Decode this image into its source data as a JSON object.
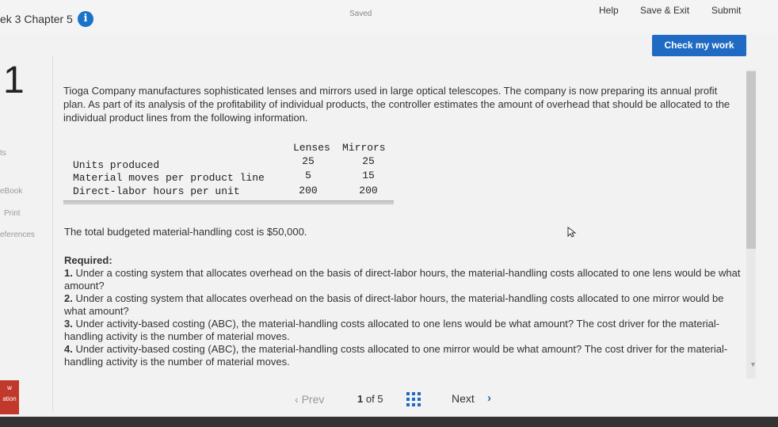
{
  "header": {
    "chapter": "ek 3 Chapter 5",
    "info_icon_glyph": "i",
    "status": "Saved",
    "help": "Help",
    "save_exit": "Save & Exit",
    "submit": "Submit",
    "check_my_work": "Check my work"
  },
  "question_number": "1",
  "sidebar": {
    "items": [
      "ts",
      "eBook",
      "Print",
      "eferences"
    ]
  },
  "problem": {
    "text": "Tioga Company manufactures sophisticated lenses and mirrors used in large optical telescopes. The company is now preparing its annual profit plan. As part of its analysis of the profitability of individual products, the controller estimates the amount of overhead that should be allocated to the individual product lines from the following information.",
    "table": {
      "columns": [
        "Lenses",
        "Mirrors"
      ],
      "rows": [
        {
          "label": "Units produced",
          "values": [
            "25",
            "25"
          ]
        },
        {
          "label": "Material moves per product line",
          "values": [
            "5",
            "15"
          ]
        },
        {
          "label": "Direct-labor hours per unit",
          "values": [
            "200",
            "200"
          ]
        }
      ]
    },
    "budget": "The total budgeted material-handling cost is $50,000."
  },
  "required": {
    "title": "Required:",
    "items": [
      {
        "num": "1.",
        "text": "Under a costing system that allocates overhead on the basis of direct-labor hours, the material-handling costs allocated to one lens would be what amount?"
      },
      {
        "num": "2.",
        "text": "Under a costing system that allocates overhead on the basis of direct-labor hours, the material-handling costs allocated to one mirror would be what amount?"
      },
      {
        "num": "3.",
        "text": "Under activity-based costing (ABC), the material-handling costs allocated to one lens would be what amount? The cost driver for the material-handling activity is the number of material moves."
      },
      {
        "num": "4.",
        "text": "Under activity-based costing (ABC), the material-handling costs allocated to one mirror would be what amount? The cost driver for the material-handling activity is the number of material moves."
      }
    ]
  },
  "footer": {
    "prev": "Prev",
    "page_current": "1",
    "page_of": "of",
    "page_total": "5",
    "next": "Next",
    "next_glyph": "›"
  },
  "colors": {
    "accent": "#1f6ac2",
    "info": "#1a73c9"
  },
  "icons": [
    "info-icon",
    "cursor-icon",
    "grid-icon",
    "chevron-right-icon",
    "scroll-down-icon"
  ]
}
